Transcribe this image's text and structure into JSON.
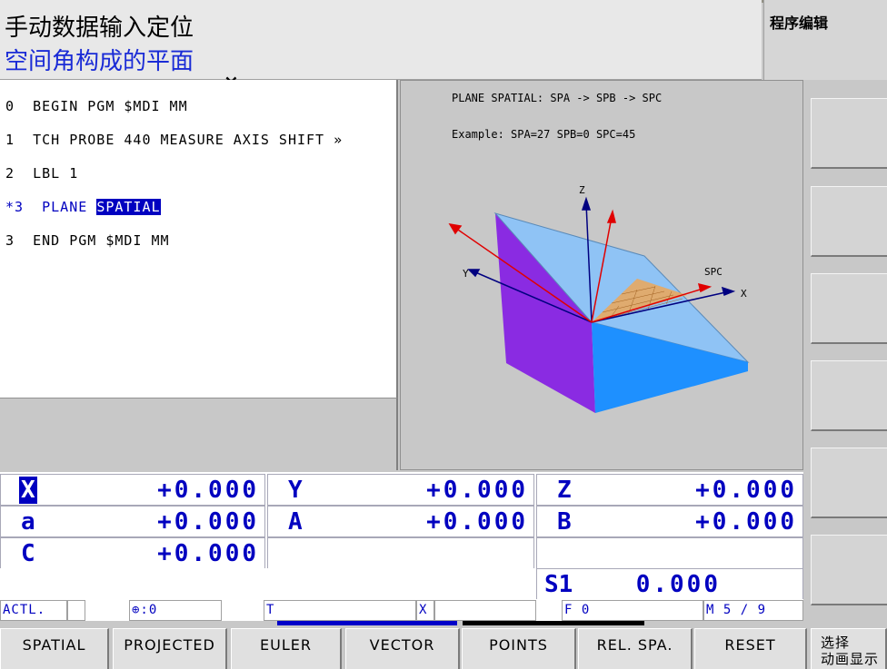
{
  "header": {
    "mode_title": "手动数据输入定位",
    "mode_subtitle": "空间角构成的平面",
    "side_title": "程序编辑",
    "close_symbol": "×"
  },
  "program": {
    "lines": [
      {
        "number": "0",
        "text": "BEGIN PGM $MDI MM",
        "active": false
      },
      {
        "number": "1",
        "text": "TCH PROBE 440 MEASURE AXIS SHIFT »",
        "active": false
      },
      {
        "number": "2",
        "text": "LBL 1",
        "active": false
      },
      {
        "number": "*3",
        "text": "PLANE",
        "highlight": "SPATIAL",
        "active": true
      },
      {
        "number": "3",
        "text": "END PGM $MDI MM",
        "active": false
      }
    ]
  },
  "help_graphic": {
    "line1": "PLANE SPATIAL: SPA -> SPB -> SPC",
    "line2": "Example: SPA=27 SPB=0 SPC=45",
    "label_z": "Z",
    "label_y": "Y",
    "label_x": "X",
    "label_spc": "SPC",
    "colors": {
      "face_left": "#8a2be2",
      "face_top": "#8fc3f5",
      "face_front": "#1e90ff",
      "axis_blue": "#000080",
      "axis_red": "#e00000",
      "grid": "#e8a860"
    }
  },
  "positions": {
    "rows": [
      [
        {
          "axis": "X",
          "value": "+0.000",
          "selected": true
        },
        {
          "axis": "Y",
          "value": "+0.000"
        },
        {
          "axis": "Z",
          "value": "+0.000"
        }
      ],
      [
        {
          "axis": "a",
          "value": "+0.000"
        },
        {
          "axis": "A",
          "value": "+0.000"
        },
        {
          "axis": "B",
          "value": "+0.000"
        }
      ],
      [
        {
          "axis": "C",
          "value": "+0.000"
        }
      ]
    ],
    "spindle": {
      "label": "S1",
      "value": "0.000"
    }
  },
  "status_bar": {
    "mode": "ACTL.",
    "datum": "⊕:0",
    "tool": "T",
    "axis": "X",
    "feed": "F 0",
    "misc": "M 5 / 9"
  },
  "softkeys": [
    {
      "label": "SPATIAL"
    },
    {
      "label": "PROJECTED"
    },
    {
      "label": "EULER"
    },
    {
      "label": "VECTOR"
    },
    {
      "label": "POINTS"
    },
    {
      "label": "REL. SPA."
    },
    {
      "label": "RESET"
    },
    {
      "label": "选择\n动画显示"
    }
  ]
}
